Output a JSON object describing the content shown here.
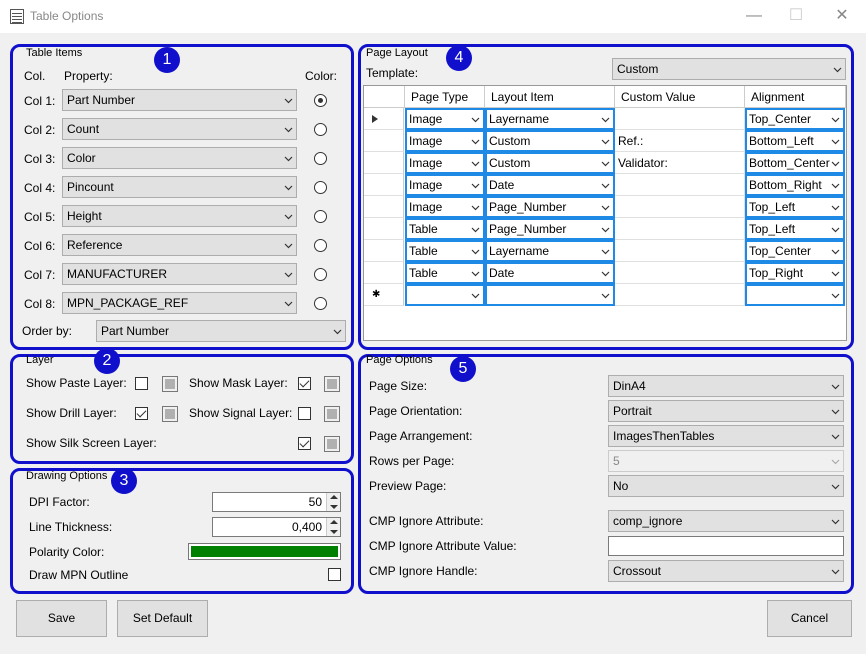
{
  "window": {
    "title": "Table Options",
    "minimize": "—",
    "maximize": "☐",
    "close": "✕"
  },
  "badges": [
    "1",
    "2",
    "3",
    "4",
    "5"
  ],
  "table_items": {
    "legend": "Table Items",
    "col_header": "Col.",
    "property_header": "Property:",
    "color_header": "Color:",
    "rows": [
      {
        "label": "Col 1:",
        "value": "Part Number",
        "color_selected": true
      },
      {
        "label": "Col 2:",
        "value": "Count",
        "color_selected": false
      },
      {
        "label": "Col 3:",
        "value": "Color",
        "color_selected": false
      },
      {
        "label": "Col 4:",
        "value": "Pincount",
        "color_selected": false
      },
      {
        "label": "Col 5:",
        "value": "Height",
        "color_selected": false
      },
      {
        "label": "Col 6:",
        "value": "Reference",
        "color_selected": false
      },
      {
        "label": "Col 7:",
        "value": "MANUFACTURER",
        "color_selected": false
      },
      {
        "label": "Col 8:",
        "value": "MPN_PACKAGE_REF",
        "color_selected": false
      }
    ],
    "order_by_label": "Order by:",
    "order_by_value": "Part Number"
  },
  "layer": {
    "legend": "Layer",
    "show_paste": {
      "label": "Show Paste Layer:",
      "checked": false
    },
    "show_mask": {
      "label": "Show Mask Layer:",
      "checked": true
    },
    "show_drill": {
      "label": "Show Drill Layer:",
      "checked": true
    },
    "show_signal": {
      "label": "Show Signal Layer:",
      "checked": false
    },
    "show_silk": {
      "label": "Show Silk Screen Layer:",
      "checked": true
    }
  },
  "drawing_options": {
    "legend": "Drawing Options",
    "dpi_label": "DPI Factor:",
    "dpi_value": "50",
    "line_label": "Line Thickness:",
    "line_value": "0,400",
    "polarity_label": "Polarity Color:",
    "polarity_color": "#008000",
    "mpn_outline_label": "Draw MPN Outline",
    "mpn_outline_checked": false
  },
  "page_layout": {
    "legend": "Page Layout",
    "template_label": "Template:",
    "template_value": "Custom",
    "columns": [
      "Page Type",
      "Layout Item",
      "Custom Value",
      "Alignment"
    ],
    "rows": [
      {
        "page_type": "Image",
        "layout_item": "Layername",
        "custom_value": "",
        "alignment": "Top_Center"
      },
      {
        "page_type": "Image",
        "layout_item": "Custom",
        "custom_value": "Ref.:",
        "alignment": "Bottom_Left"
      },
      {
        "page_type": "Image",
        "layout_item": "Custom",
        "custom_value": "Validator:",
        "alignment": "Bottom_Center"
      },
      {
        "page_type": "Image",
        "layout_item": "Date",
        "custom_value": "",
        "alignment": "Bottom_Right"
      },
      {
        "page_type": "Image",
        "layout_item": "Page_Number",
        "custom_value": "",
        "alignment": "Top_Left"
      },
      {
        "page_type": "Table",
        "layout_item": "Page_Number",
        "custom_value": "",
        "alignment": "Top_Left"
      },
      {
        "page_type": "Table",
        "layout_item": "Layername",
        "custom_value": "",
        "alignment": "Top_Center"
      },
      {
        "page_type": "Table",
        "layout_item": "Date",
        "custom_value": "",
        "alignment": "Top_Right"
      },
      {
        "page_type": "",
        "layout_item": "",
        "custom_value": "",
        "alignment": ""
      }
    ]
  },
  "page_options": {
    "legend": "Page Options",
    "page_size": {
      "label": "Page Size:",
      "value": "DinA4"
    },
    "orientation": {
      "label": "Page Orientation:",
      "value": "Portrait"
    },
    "arrangement": {
      "label": "Page Arrangement:",
      "value": "ImagesThenTables"
    },
    "rows_per_page": {
      "label": "Rows per Page:",
      "value": "5"
    },
    "preview_page": {
      "label": "Preview Page:",
      "value": "No"
    },
    "cmp_ignore_attr": {
      "label": "CMP Ignore Attribute:",
      "value": "comp_ignore"
    },
    "cmp_ignore_attr_value": {
      "label": "CMP Ignore Attribute Value:",
      "value": ""
    },
    "cmp_ignore_handle": {
      "label": "CMP Ignore Handle:",
      "value": "Crossout"
    }
  },
  "buttons": {
    "save": "Save",
    "set_default": "Set Default",
    "cancel": "Cancel"
  },
  "colors": {
    "accent_border": "#1010cc",
    "selection_blue": "#1e8ae6"
  }
}
